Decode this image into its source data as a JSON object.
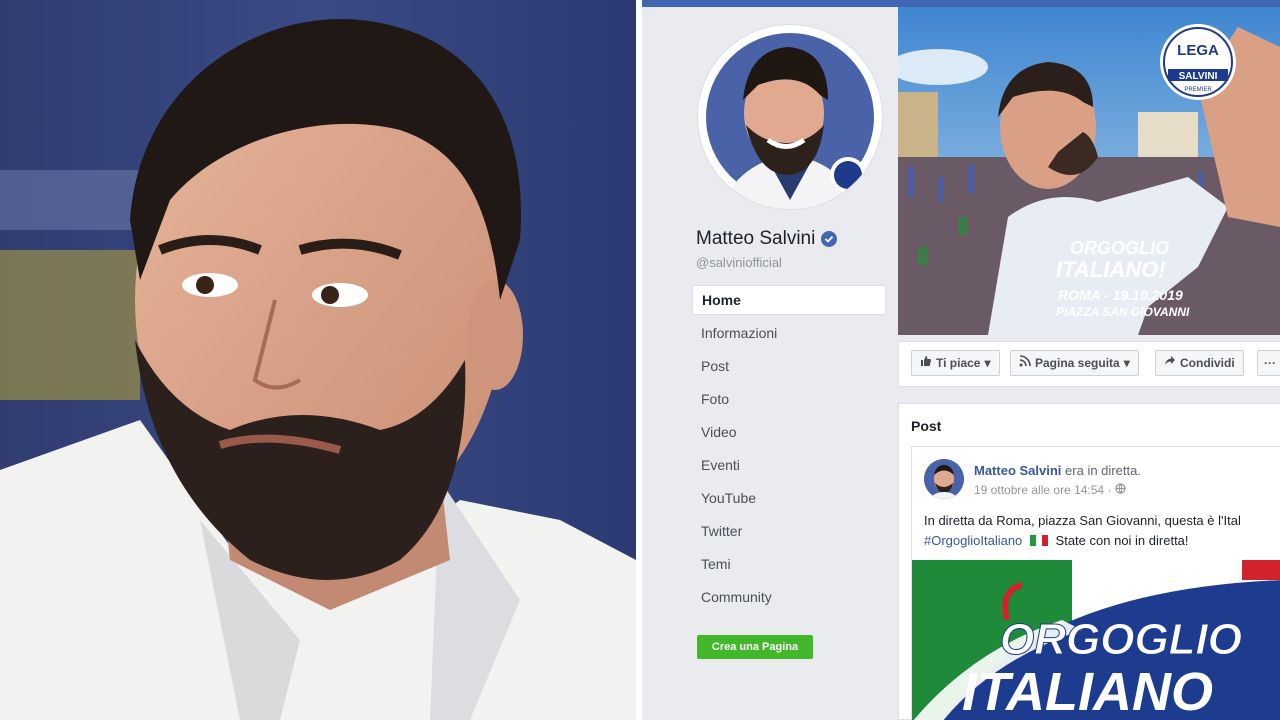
{
  "profile": {
    "name": "Matteo Salvini",
    "handle": "@salviniofficial"
  },
  "nav": {
    "items": [
      {
        "label": "Home",
        "active": true
      },
      {
        "label": "Informazioni"
      },
      {
        "label": "Post"
      },
      {
        "label": "Foto"
      },
      {
        "label": "Video"
      },
      {
        "label": "Eventi"
      },
      {
        "label": "YouTube"
      },
      {
        "label": "Twitter"
      },
      {
        "label": "Temi"
      },
      {
        "label": "Community"
      }
    ],
    "create_page": "Crea una Pagina"
  },
  "cover": {
    "logo_top": "LEGA",
    "logo_bottom": "SALVINI",
    "logo_sub": "PREMIER",
    "line1": "ORGOGLIO",
    "line2": "ITALIANO!",
    "line3": "ROMA - 19.10.2019",
    "line4": "PIAZZA SAN GIOVANNI"
  },
  "actions": {
    "like": "Ti piace",
    "follow": "Pagina seguita",
    "share": "Condividi",
    "more": "···"
  },
  "posts": {
    "header": "Post",
    "author": "Matteo Salvini",
    "action": "era in diretta.",
    "timestamp": "19 ottobre alle ore 14:54 ·",
    "text_line1": "In diretta da Roma, piazza San Giovanni, questa è l'Ital",
    "hashtag": "#OrgoglioItaliano",
    "text_line2_rest": "State con noi in diretta!",
    "image_line1": "ORGOGLIO",
    "image_line2": "ITALIANO"
  },
  "colors": {
    "facebook_blue": "#4267b2",
    "link_blue": "#365899",
    "create_green": "#42b72a",
    "background": "#e9ebee"
  }
}
